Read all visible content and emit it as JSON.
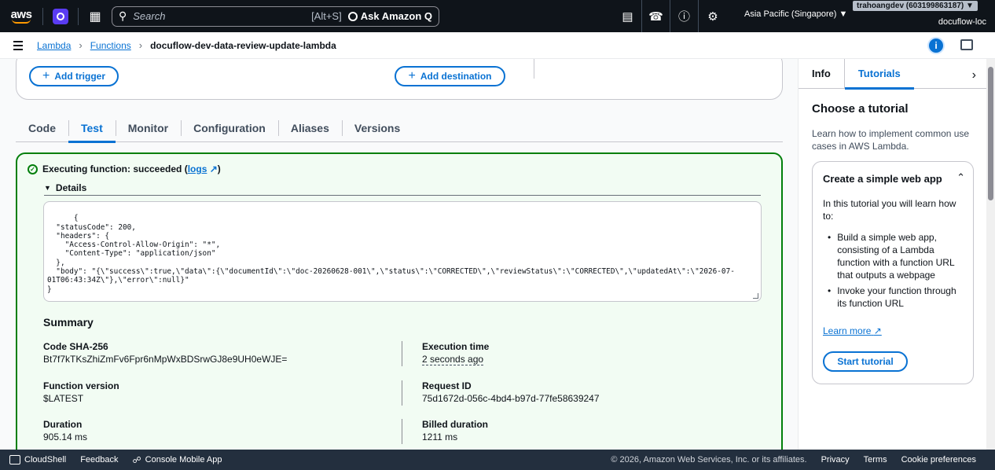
{
  "topnav": {
    "logo_text": "aws",
    "search_placeholder": "Search",
    "search_shortcut": "[Alt+S]",
    "ask_q": "Ask Amazon Q",
    "region": "Asia Pacific (Singapore) ▼",
    "account": "trahoangdev (603199863187) ▼",
    "user": "docuflow-loc"
  },
  "breadcrumb": {
    "items": [
      "Lambda",
      "Functions"
    ],
    "current": "docuflow-dev-data-review-update-lambda"
  },
  "diagram": {
    "add_trigger": "Add trigger",
    "add_destination": "Add destination"
  },
  "tabs": [
    "Code",
    "Test",
    "Monitor",
    "Configuration",
    "Aliases",
    "Versions"
  ],
  "active_tab": "Test",
  "result": {
    "status_prefix": "Executing function: succeeded (",
    "logs_label": "logs",
    "status_suffix": ")",
    "details_label": "Details",
    "output": "{\n  \"statusCode\": 200,\n  \"headers\": {\n    \"Access-Control-Allow-Origin\": \"*\",\n    \"Content-Type\": \"application/json\"\n  },\n  \"body\": \"{\\\"success\\\":true,\\\"data\\\":{\\\"documentId\\\":\\\"doc-20260628-001\\\",\\\"status\\\":\\\"CORRECTED\\\",\\\"reviewStatus\\\":\\\"CORRECTED\\\",\\\"updatedAt\\\":\\\"2026-07-01T06:43:34Z\\\"},\\\"error\\\":null}\"\n}",
    "summary_title": "Summary",
    "summary": {
      "sha_label": "Code SHA-256",
      "sha_value": "Bt7f7kTKsZhiZmFv6Fpr6nMpWxBDSrwGJ8e9UH0eWJE=",
      "exec_label": "Execution time",
      "exec_value": "2 seconds ago",
      "version_label": "Function version",
      "version_value": "$LATEST",
      "request_label": "Request ID",
      "request_value": "75d1672d-056c-4bd4-b97d-77fe58639247",
      "duration_label": "Duration",
      "duration_value": "905.14 ms",
      "billed_label": "Billed duration",
      "billed_value": "1211 ms"
    }
  },
  "panel": {
    "tabs": [
      "Info",
      "Tutorials"
    ],
    "active_tab": "Tutorials",
    "title": "Choose a tutorial",
    "description": "Learn how to implement common use cases in AWS Lambda.",
    "card": {
      "title": "Create a simple web app",
      "intro": "In this tutorial you will learn how to:",
      "bullets": [
        "Build a simple web app, consisting of a Lambda function with a function URL that outputs a webpage",
        "Invoke your function through its function URL"
      ],
      "learn_more": "Learn more",
      "start": "Start tutorial"
    }
  },
  "footer": {
    "cloudshell": "CloudShell",
    "feedback": "Feedback",
    "mobile": "Console Mobile App",
    "copyright": "© 2026, Amazon Web Services, Inc. or its affiliates.",
    "privacy": "Privacy",
    "terms": "Terms",
    "cookies": "Cookie preferences"
  },
  "colors": {
    "accent": "#0972d3",
    "success": "#037f0c",
    "nav_bg": "#0f141a",
    "footer_bg": "#232f3e"
  },
  "icons": [
    "menu-icon",
    "grid-icon",
    "search-icon",
    "cloudshell-icon",
    "bell-icon",
    "help-icon",
    "settings-icon",
    "info-icon",
    "feedback-icon",
    "success-icon",
    "external-link-icon"
  ]
}
